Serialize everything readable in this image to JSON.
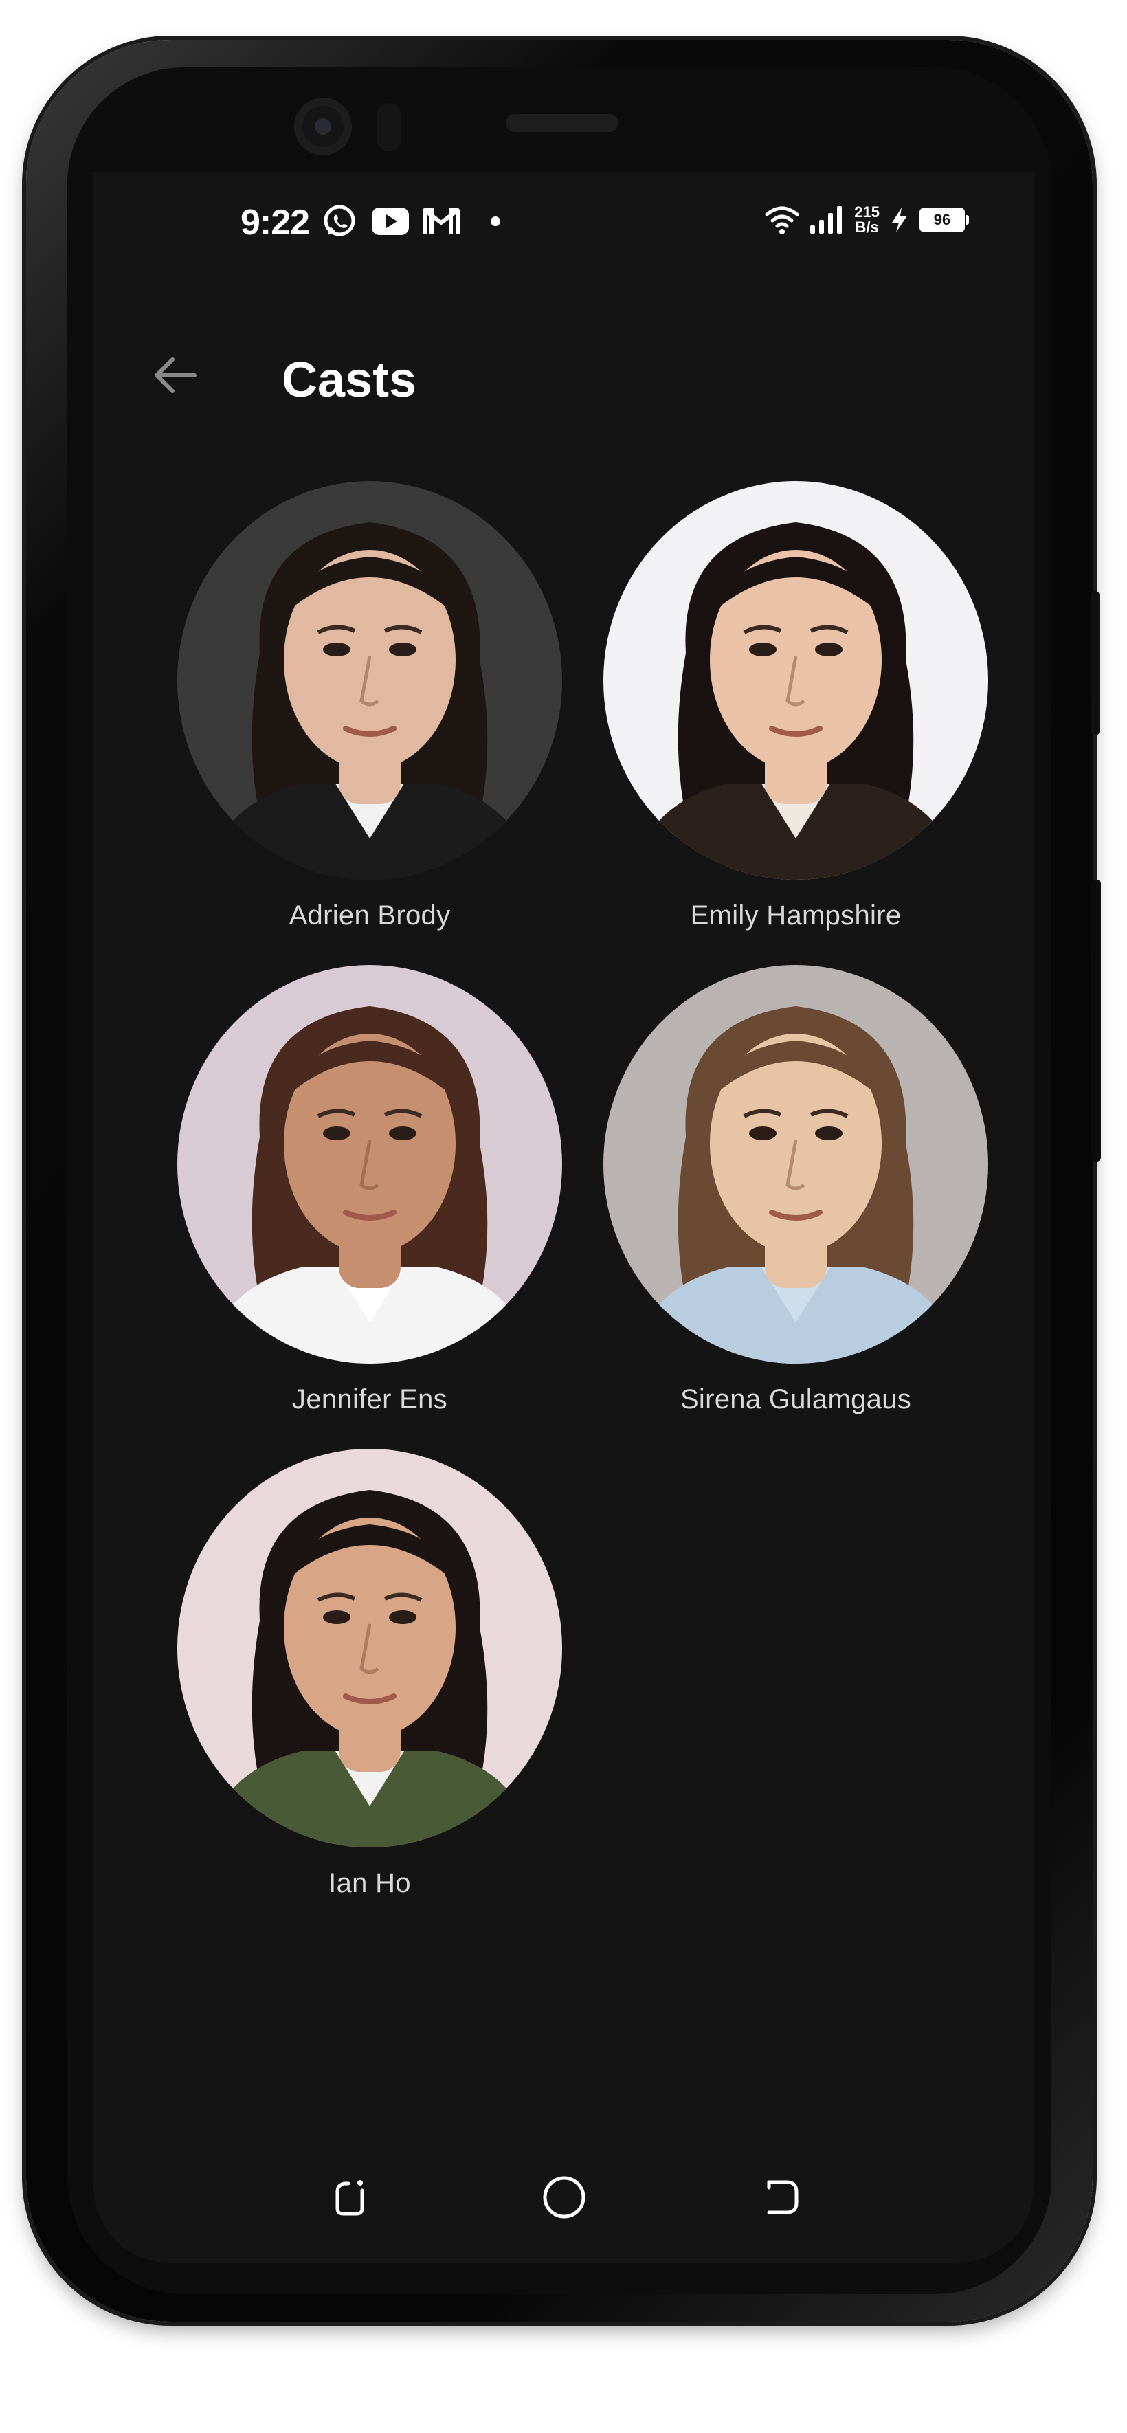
{
  "status_bar": {
    "time": "9:22",
    "net_speed_value": "215",
    "net_speed_unit": "B/s",
    "battery_level": "96",
    "notification_icons": [
      "whatsapp-icon",
      "youtube-icon",
      "gmail-icon"
    ],
    "system_icons": [
      "wifi-icon",
      "cellular-signal-icon",
      "charging-icon",
      "battery-icon"
    ]
  },
  "header": {
    "title": "Casts",
    "back_icon": "arrow-left-icon"
  },
  "cast": [
    {
      "name": "Adrien Brody",
      "bg": "#3a3a3a",
      "skin": "#e0b9a0",
      "hair": "#1e1612",
      "shirt": "#1b1b1b",
      "collar": "#f1f1f1"
    },
    {
      "name": "Emily Hampshire",
      "bg": "#f2f2f4",
      "skin": "#e9c2a8",
      "hair": "#1a1210",
      "shirt": "#2a211c",
      "collar": "#efe8e0"
    },
    {
      "name": "Jennifer Ens",
      "bg": "#d8cbd4",
      "skin": "#c58f70",
      "hair": "#4a2a1e",
      "shirt": "#f4f4f4",
      "collar": "#ffffff"
    },
    {
      "name": "Sirena Gulamgaus",
      "bg": "#b9b4b2",
      "skin": "#e8c4a6",
      "hair": "#6b4a34",
      "shirt": "#b8cde0",
      "collar": "#cfdeec"
    },
    {
      "name": "Ian Ho",
      "bg": "#ead9da",
      "skin": "#d8a686",
      "hair": "#1b1412",
      "shirt": "#4b5a36",
      "collar": "#f2f2f2"
    }
  ],
  "nav": {
    "recents_icon": "recents-icon",
    "home_icon": "home-circle-icon",
    "back_icon": "back-nav-icon"
  }
}
